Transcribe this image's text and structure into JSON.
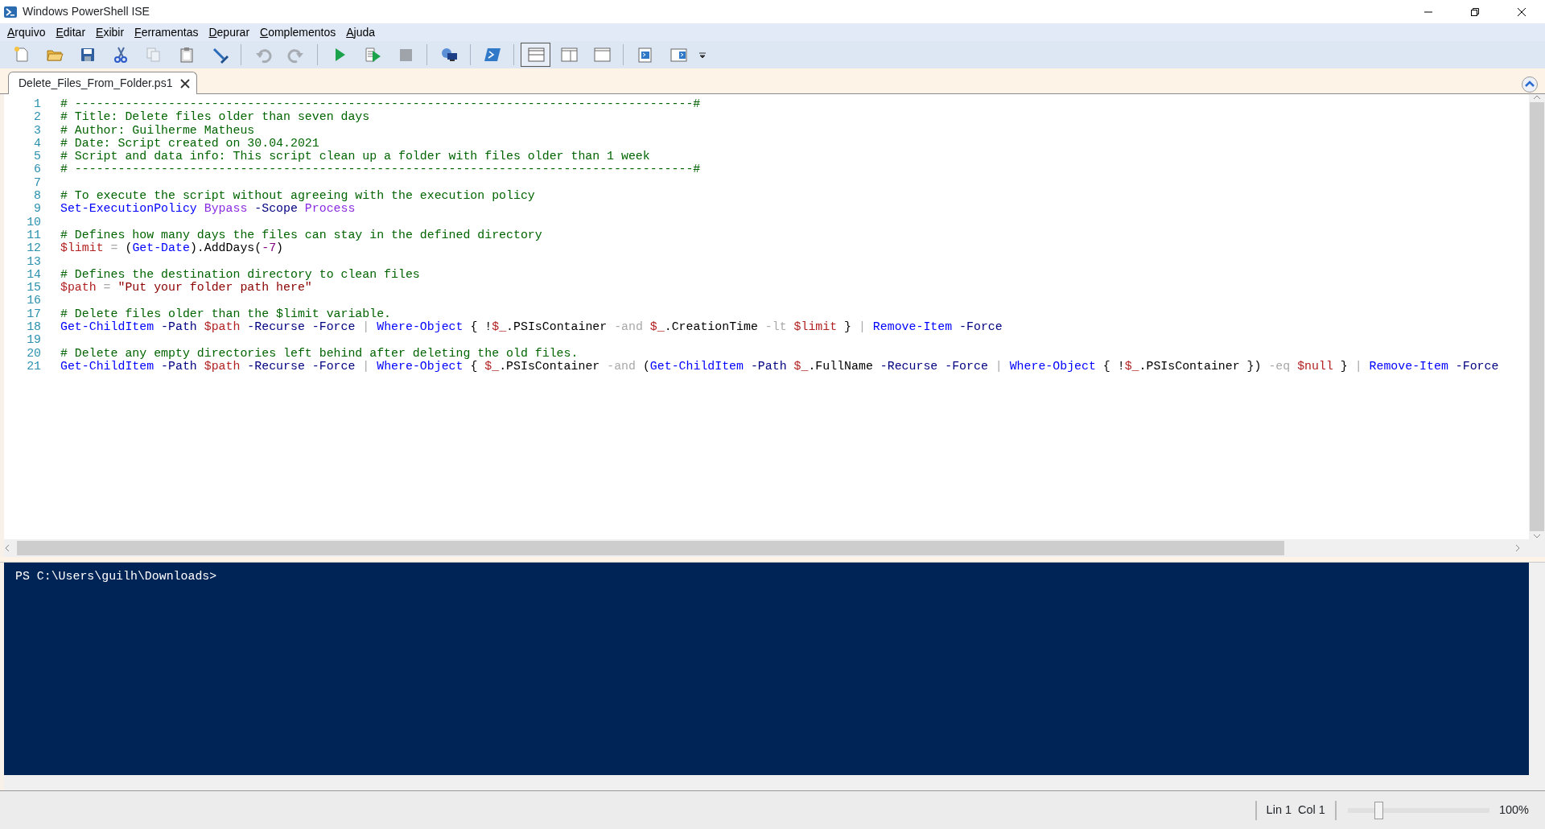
{
  "window": {
    "title": "Windows PowerShell ISE"
  },
  "menu": [
    "Arquivo",
    "Editar",
    "Exibir",
    "Ferramentas",
    "Depurar",
    "Complementos",
    "Ajuda"
  ],
  "toolbar": [
    {
      "kind": "new",
      "disabled": false
    },
    {
      "kind": "open",
      "disabled": false
    },
    {
      "kind": "save",
      "disabled": false
    },
    {
      "kind": "cut",
      "disabled": false
    },
    {
      "kind": "copy",
      "disabled": true
    },
    {
      "kind": "paste",
      "disabled": false
    },
    {
      "kind": "clear",
      "disabled": false
    },
    {
      "kind": "sep"
    },
    {
      "kind": "undo",
      "disabled": true
    },
    {
      "kind": "redo",
      "disabled": true
    },
    {
      "kind": "sep"
    },
    {
      "kind": "run",
      "disabled": false
    },
    {
      "kind": "runsel",
      "disabled": false
    },
    {
      "kind": "stop",
      "disabled": true
    },
    {
      "kind": "sep"
    },
    {
      "kind": "remote",
      "disabled": false
    },
    {
      "kind": "sep"
    },
    {
      "kind": "shell",
      "disabled": false
    },
    {
      "kind": "sep"
    },
    {
      "kind": "paneTop",
      "disabled": false,
      "selected": true
    },
    {
      "kind": "paneRight",
      "disabled": false,
      "selected": false
    },
    {
      "kind": "paneMax",
      "disabled": false,
      "selected": false
    },
    {
      "kind": "sep"
    },
    {
      "kind": "commands",
      "disabled": false
    },
    {
      "kind": "addon",
      "disabled": false
    }
  ],
  "tabs": [
    {
      "label": "Delete_Files_From_Folder.ps1",
      "selected": true
    }
  ],
  "editor": {
    "lines": [
      {
        "number": "1",
        "tokens": [
          {
            "kind": "comment",
            "text": "# --------------------------------------------------------------------------------------#"
          }
        ]
      },
      {
        "number": "2",
        "tokens": [
          {
            "kind": "comment",
            "text": "# Title: Delete files older than seven days"
          }
        ]
      },
      {
        "number": "3",
        "tokens": [
          {
            "kind": "comment",
            "text": "# Author: Guilherme Matheus"
          }
        ]
      },
      {
        "number": "4",
        "tokens": [
          {
            "kind": "comment",
            "text": "# Date: Script created on 30.04.2021"
          }
        ]
      },
      {
        "number": "5",
        "tokens": [
          {
            "kind": "comment",
            "text": "# Script and data info: This script clean up a folder with files older than 1 week"
          }
        ]
      },
      {
        "number": "6",
        "tokens": [
          {
            "kind": "comment",
            "text": "# --------------------------------------------------------------------------------------#"
          }
        ]
      },
      {
        "number": "7"
      },
      {
        "number": "8",
        "tokens": [
          {
            "kind": "comment",
            "text": "# To execute the script without agreeing with the execution policy"
          }
        ]
      },
      {
        "number": "9",
        "tokens": [
          {
            "kind": "cmdlet",
            "text": "Set-ExecutionPolicy"
          },
          {
            "kind": "argument",
            "text": " Bypass"
          },
          {
            "kind": "parameter",
            "text": " -Scope"
          },
          {
            "kind": "argument",
            "text": " Process"
          }
        ]
      },
      {
        "number": "10"
      },
      {
        "number": "11",
        "tokens": [
          {
            "kind": "comment",
            "text": "# Defines how many days the files can stay in the defined directory"
          }
        ]
      },
      {
        "number": "12",
        "tokens": [
          {
            "kind": "variable",
            "text": "$limit"
          },
          {
            "kind": "operator",
            "text": " ="
          },
          {
            "kind": "plain",
            "text": " ("
          },
          {
            "kind": "cmdlet",
            "text": "Get-Date"
          },
          {
            "kind": "plain",
            "text": ").AddDays("
          },
          {
            "kind": "number",
            "text": "-7"
          },
          {
            "kind": "plain",
            "text": ")"
          }
        ]
      },
      {
        "number": "13"
      },
      {
        "number": "14",
        "tokens": [
          {
            "kind": "comment",
            "text": "# Defines the destination directory to clean files"
          }
        ]
      },
      {
        "number": "15",
        "tokens": [
          {
            "kind": "variable",
            "text": "$path"
          },
          {
            "kind": "operator",
            "text": " ="
          },
          {
            "kind": "string",
            "text": " \"Put your folder path here\""
          }
        ]
      },
      {
        "number": "16"
      },
      {
        "number": "17",
        "tokens": [
          {
            "kind": "comment",
            "text": "# Delete files older than the $limit variable."
          }
        ]
      },
      {
        "number": "18",
        "tokens": [
          {
            "kind": "cmdlet",
            "text": "Get-ChildItem"
          },
          {
            "kind": "parameter",
            "text": " -Path"
          },
          {
            "kind": "variable",
            "text": " $path"
          },
          {
            "kind": "parameter",
            "text": " -Recurse"
          },
          {
            "kind": "parameter",
            "text": " -Force"
          },
          {
            "kind": "operator",
            "text": " |"
          },
          {
            "kind": "cmdlet",
            "text": " Where-Object"
          },
          {
            "kind": "plain",
            "text": " { !"
          },
          {
            "kind": "variable",
            "text": "$_"
          },
          {
            "kind": "plain",
            "text": ".PSIsContainer"
          },
          {
            "kind": "operator",
            "text": " -and"
          },
          {
            "kind": "variable",
            "text": " $_"
          },
          {
            "kind": "plain",
            "text": ".CreationTime"
          },
          {
            "kind": "operator",
            "text": " -lt"
          },
          {
            "kind": "variable",
            "text": " $limit"
          },
          {
            "kind": "plain",
            "text": " }"
          },
          {
            "kind": "operator",
            "text": " |"
          },
          {
            "kind": "cmdlet",
            "text": " Remove-Item"
          },
          {
            "kind": "parameter",
            "text": " -Force"
          }
        ]
      },
      {
        "number": "19"
      },
      {
        "number": "20",
        "tokens": [
          {
            "kind": "comment",
            "text": "# Delete any empty directories left behind after deleting the old files."
          }
        ]
      },
      {
        "number": "21",
        "tokens": [
          {
            "kind": "cmdlet",
            "text": "Get-ChildItem"
          },
          {
            "kind": "parameter",
            "text": " -Path"
          },
          {
            "kind": "variable",
            "text": " $path"
          },
          {
            "kind": "parameter",
            "text": " -Recurse"
          },
          {
            "kind": "parameter",
            "text": " -Force"
          },
          {
            "kind": "operator",
            "text": " |"
          },
          {
            "kind": "cmdlet",
            "text": " Where-Object"
          },
          {
            "kind": "plain",
            "text": " {"
          },
          {
            "kind": "variable",
            "text": " $_"
          },
          {
            "kind": "plain",
            "text": ".PSIsContainer"
          },
          {
            "kind": "operator",
            "text": " -and"
          },
          {
            "kind": "plain",
            "text": " ("
          },
          {
            "kind": "cmdlet",
            "text": "Get-ChildItem"
          },
          {
            "kind": "parameter",
            "text": " -Path"
          },
          {
            "kind": "variable",
            "text": " $_"
          },
          {
            "kind": "plain",
            "text": ".FullName"
          },
          {
            "kind": "parameter",
            "text": " -Recurse"
          },
          {
            "kind": "parameter",
            "text": " -Force"
          },
          {
            "kind": "operator",
            "text": " |"
          },
          {
            "kind": "cmdlet",
            "text": " Where-Object"
          },
          {
            "kind": "plain",
            "text": " { !"
          },
          {
            "kind": "variable",
            "text": "$_"
          },
          {
            "kind": "plain",
            "text": ".PSIsContainer })"
          },
          {
            "kind": "operator",
            "text": " -eq"
          },
          {
            "kind": "variable",
            "text": " $null"
          },
          {
            "kind": "plain",
            "text": " }"
          },
          {
            "kind": "operator",
            "text": " |"
          },
          {
            "kind": "cmdlet",
            "text": " Remove-Item"
          },
          {
            "kind": "parameter",
            "text": " -Force"
          }
        ]
      }
    ]
  },
  "console": {
    "prompt": "PS C:\\Users\\guilh\\Downloads>"
  },
  "status_bar": {
    "line": "Lin 1",
    "column": "Col 1",
    "zoom": {
      "level": 0.2,
      "reading": "100%"
    }
  }
}
